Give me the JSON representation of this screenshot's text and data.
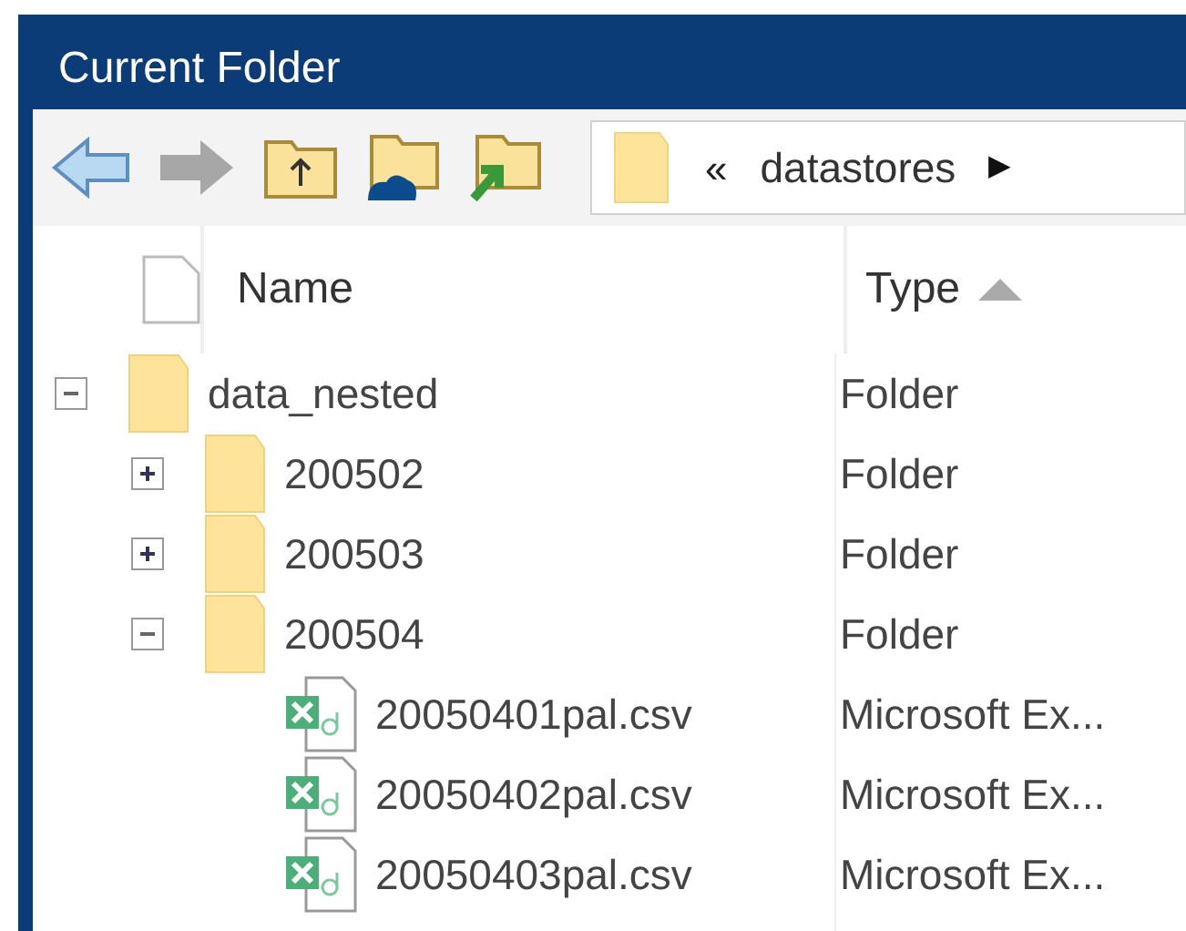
{
  "panel": {
    "title": "Current Folder"
  },
  "address": {
    "overflow": "«",
    "path": "datastores",
    "arrow": "▶"
  },
  "columns": [
    {
      "label": "Name",
      "sorted": false
    },
    {
      "label": "Type",
      "sorted": true
    }
  ],
  "tree": [
    {
      "name": "data_nested",
      "type": "Folder",
      "kind": "folder",
      "expanded": true,
      "children": [
        {
          "name": "200502",
          "type": "Folder",
          "kind": "folder",
          "expanded": false
        },
        {
          "name": "200503",
          "type": "Folder",
          "kind": "folder",
          "expanded": false
        },
        {
          "name": "200504",
          "type": "Folder",
          "kind": "folder",
          "expanded": true,
          "children": [
            {
              "name": "20050401pal.csv",
              "type": "Microsoft Ex...",
              "kind": "csv"
            },
            {
              "name": "20050402pal.csv",
              "type": "Microsoft Ex...",
              "kind": "csv"
            },
            {
              "name": "20050403pal.csv",
              "type": "Microsoft Ex...",
              "kind": "csv"
            }
          ]
        }
      ]
    }
  ]
}
